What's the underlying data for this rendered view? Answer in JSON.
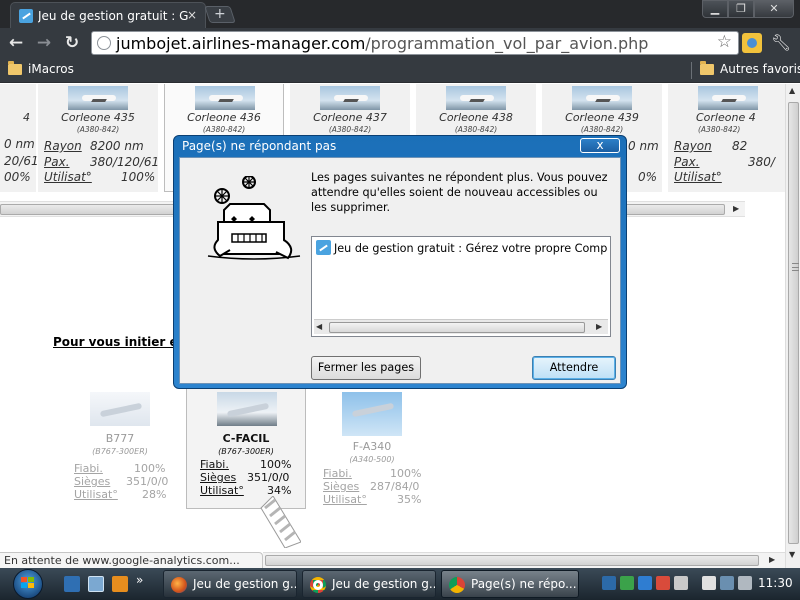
{
  "browser": {
    "tab_title": "Jeu de gestion gratuit : G...",
    "tab_close": "×",
    "newtab_label": "+",
    "url_host": "jumbojet.airlines-manager.com",
    "url_path": "/programmation_vol_par_avion.php",
    "bookmarks": [
      "iMacros",
      "Autres favoris"
    ]
  },
  "aircraft_cards": [
    {
      "name": "4",
      "model": "",
      "stats": [
        [
          "",
          "0 nm"
        ],
        [
          "",
          "20/61"
        ],
        [
          "",
          "00%"
        ]
      ]
    },
    {
      "name": "Corleone 435",
      "model": "(A380-842)",
      "stats": [
        [
          "Rayon",
          "8200 nm"
        ],
        [
          "Pax.",
          "380/120/61"
        ],
        [
          "Utilisat°",
          "100%"
        ]
      ]
    },
    {
      "name": "Corleone 436",
      "model": "(A380-842)",
      "stats": [
        [
          "",
          ""
        ],
        [
          "",
          ""
        ],
        [
          "",
          ""
        ]
      ]
    },
    {
      "name": "Corleone 437",
      "model": "(A380-842)",
      "stats": [
        [
          "",
          ""
        ],
        [
          "",
          ""
        ],
        [
          "",
          ""
        ]
      ]
    },
    {
      "name": "Corleone 438",
      "model": "(A380-842)",
      "stats": [
        [
          "",
          ""
        ],
        [
          "",
          ""
        ],
        [
          "",
          ""
        ]
      ]
    },
    {
      "name": "Corleone 439",
      "model": "(A380-842)",
      "stats": [
        [
          "",
          "0 nm"
        ],
        [
          "",
          ""
        ],
        [
          "",
          "0%"
        ]
      ]
    },
    {
      "name": "Corleone 4",
      "model": "(A380-842)",
      "stats": [
        [
          "Rayon",
          "82"
        ],
        [
          "Pax.",
          "380/"
        ],
        [
          "Utilisat°",
          ""
        ]
      ]
    }
  ],
  "intro_link": "Pour vous initier en v",
  "fleet": [
    {
      "name": "B777",
      "model": "(B767-300ER)",
      "rows": [
        [
          "Fiabi.",
          "100%"
        ],
        [
          "Sièges",
          "351/0/0"
        ],
        [
          "Utilisat°",
          "28%"
        ]
      ]
    },
    {
      "name": "C-FACIL",
      "model": "(B767-300ER)",
      "rows": [
        [
          "Fiabi.",
          "100%"
        ],
        [
          "Sièges",
          "351/0/0"
        ],
        [
          "Utilisat°",
          "34%"
        ]
      ]
    },
    {
      "name": "F-A340",
      "model": "(A340-500)",
      "rows": [
        [
          "Fiabi.",
          "100%"
        ],
        [
          "Sièges",
          "287/84/0"
        ],
        [
          "Utilisat°",
          "35%"
        ]
      ]
    }
  ],
  "status_text": "En attente de www.google-analytics.com...",
  "dialog": {
    "title": "Page(s) ne répondant pas",
    "close": "x",
    "message": "Les pages suivantes ne répondent plus. Vous pouvez attendre qu'elles soient de nouveau accessibles ou les supprimer.",
    "page_item": "Jeu de gestion gratuit : Gérez votre propre Compa...",
    "btn_close_pages": "Fermer les pages",
    "btn_wait": "Attendre"
  },
  "taskbar": {
    "tasks": [
      "Jeu de gestion g...",
      "Jeu de gestion g...",
      "Page(s) ne répo..."
    ],
    "clock": "11:30",
    "more": "»"
  },
  "colors": {
    "chrome_dark": "#353a40",
    "dialog_blue": "#1b6fb8",
    "taskbar": "#1b252e"
  }
}
